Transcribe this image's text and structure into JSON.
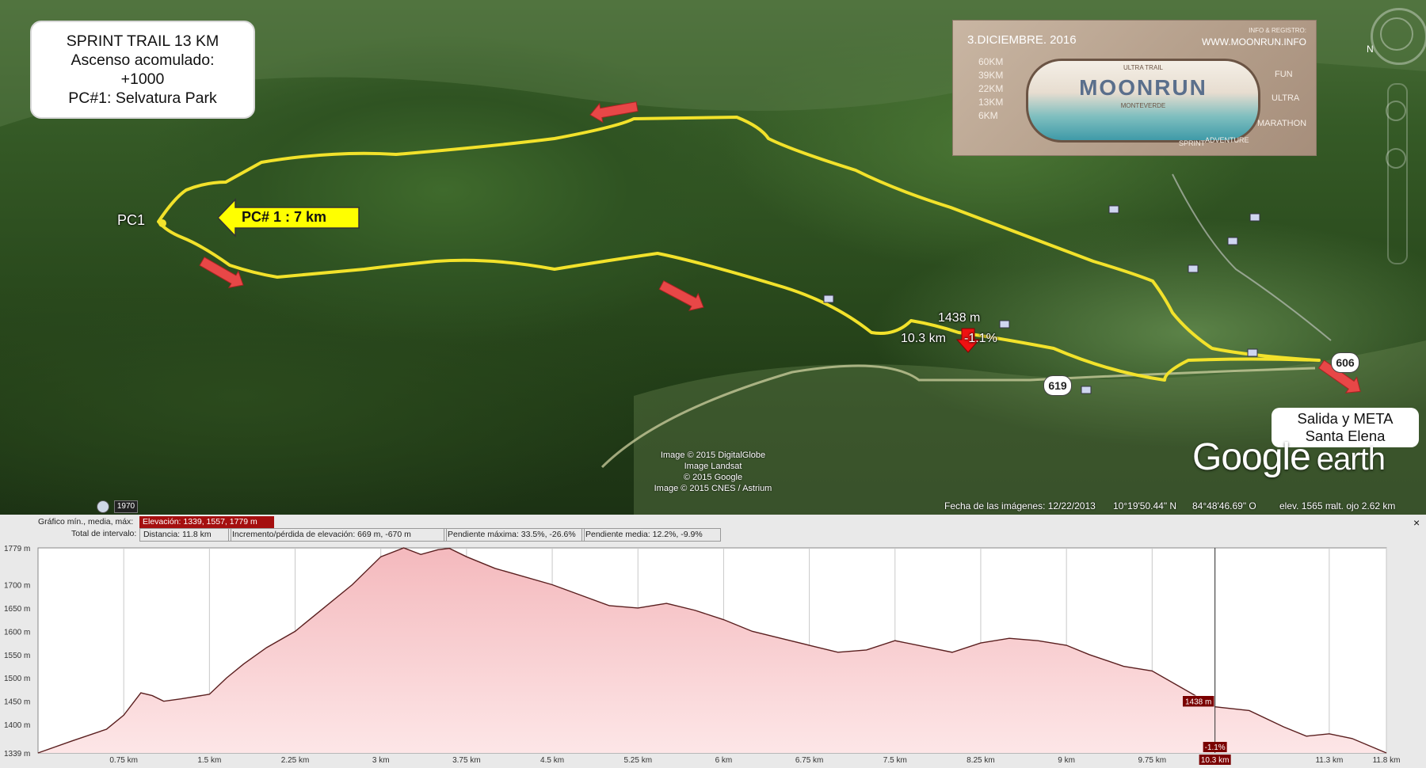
{
  "info_box": {
    "lines": [
      "SPRINT TRAIL 13 KM",
      "Ascenso acomulado:",
      "+1000",
      "PC#1: Selvatura Park"
    ]
  },
  "poster": {
    "date": "3.DICIEMBRE. 2016",
    "website": "WWW.MOONRUN.INFO",
    "info_label": "INFO & REGISTRO:",
    "distances": [
      "60KM",
      "39KM",
      "22KM",
      "13KM",
      "6KM"
    ],
    "logo_text": "MOONRUN",
    "logo_sub_top": "ULTRA TRAIL",
    "logo_sub_bottom": "MONTEVERDE",
    "categories": [
      "FUN",
      "ULTRA",
      "MARATHON",
      "SPRINT",
      "ADVENTURE"
    ]
  },
  "map": {
    "checkpoint_callout": "PC# 1 : 7 km",
    "checkpoint_label": "PC1",
    "marker_elevation": "1438 m",
    "marker_distance": "10.3 km",
    "marker_slope": "-1.1%",
    "route_619": "619",
    "route_606": "606",
    "finish_box": [
      "Salida y META",
      "Santa Elena"
    ],
    "watermark": "Google",
    "watermark_suffix": "earth",
    "copyright": [
      "Image © 2015 DigitalGlobe",
      "Image Landsat",
      "© 2015 Google",
      "Image © 2015 CNES / Astrium"
    ],
    "year_badge": "1970",
    "status": {
      "imagery_date": "Fecha de las imágenes: 12/22/2013",
      "lat": "10°19'50.44\" N",
      "lon": "84°48'46.69\" O",
      "elev": "elev.  1565 m",
      "eye_alt": "alt. ojo   2.62 km"
    },
    "colors": {
      "trail": "#f2e22b",
      "arrow": "#e84747",
      "callout": "#ffff00"
    }
  },
  "profile_header": {
    "graph_label": "Gráfico  mín., media, máx:",
    "elevation": "Elevación: 1339, 1557, 1779 m",
    "interval_label": "Total de intervalo:",
    "distance": "Distancia: 11.8 km",
    "gain_loss": "Incremento/pérdida de elevación: 669 m, -670 m",
    "max_slope": "Pendiente máxima: 33.5%, -26.6%",
    "avg_slope": "Pendiente media: 12.2%, -9.9%",
    "close": "×"
  },
  "chart_data": {
    "type": "area",
    "xlabel": "",
    "ylabel": "",
    "xlim": [
      0,
      11.8
    ],
    "ylim": [
      1339,
      1779
    ],
    "y_ticks": [
      "1779 m",
      "1700 m",
      "1650 m",
      "1600 m",
      "1550 m",
      "1500 m",
      "1450 m",
      "1400 m",
      "1339 m"
    ],
    "y_tick_values": [
      1779,
      1700,
      1650,
      1600,
      1550,
      1500,
      1450,
      1400,
      1339
    ],
    "x_ticks": [
      "0.75 km",
      "1.5 km",
      "2.25 km",
      "3 km",
      "3.75 km",
      "4.5 km",
      "5.25 km",
      "6 km",
      "6.75 km",
      "7.5 km",
      "8.25 km",
      "9 km",
      "9.75 km",
      "10.3 km",
      "11.3 km",
      "11.8 km"
    ],
    "x_tick_values": [
      0.75,
      1.5,
      2.25,
      3,
      3.75,
      4.5,
      5.25,
      6,
      6.75,
      7.5,
      8.25,
      9,
      9.75,
      10.3,
      11.3,
      11.8
    ],
    "series": [
      {
        "x": [
          0,
          0.3,
          0.6,
          0.75,
          0.9,
          1.0,
          1.1,
          1.25,
          1.5,
          1.65,
          1.8,
          2.0,
          2.25,
          2.5,
          2.75,
          3.0,
          3.2,
          3.35,
          3.5,
          3.6,
          3.75,
          4.0,
          4.5,
          5.0,
          5.25,
          5.5,
          5.75,
          6.0,
          6.25,
          6.5,
          6.75,
          7.0,
          7.25,
          7.5,
          7.8,
          8.0,
          8.25,
          8.5,
          8.75,
          9.0,
          9.2,
          9.5,
          9.75,
          10.0,
          10.3,
          10.6,
          10.9,
          11.1,
          11.3,
          11.5,
          11.8
        ],
        "y": [
          1339,
          1365,
          1390,
          1420,
          1468,
          1462,
          1450,
          1455,
          1465,
          1500,
          1530,
          1565,
          1600,
          1650,
          1700,
          1760,
          1779,
          1765,
          1775,
          1778,
          1760,
          1735,
          1700,
          1655,
          1650,
          1660,
          1645,
          1625,
          1600,
          1585,
          1570,
          1555,
          1560,
          1580,
          1565,
          1555,
          1575,
          1585,
          1580,
          1570,
          1550,
          1525,
          1515,
          1480,
          1438,
          1430,
          1395,
          1375,
          1380,
          1370,
          1339
        ]
      }
    ],
    "marker": {
      "x": 10.3,
      "y": 1438,
      "elevation_label": "1438 m",
      "slope_label": "-1.1%"
    },
    "grid": true,
    "colors": {
      "fill_top": "#f4b9bd",
      "fill_bottom": "#fde6e7",
      "line": "#5a1f1f",
      "marker": "#7a0000"
    }
  }
}
